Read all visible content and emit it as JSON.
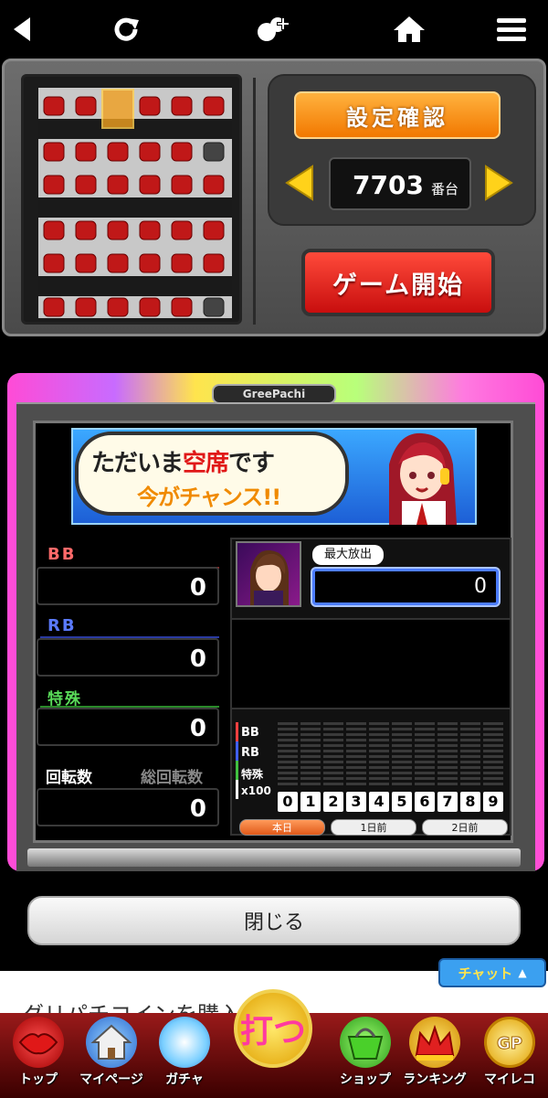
{
  "header": {
    "back_icon": "back-arrow-icon",
    "reload_icon": "reload-icon",
    "friend_icon": "add-friend-icon",
    "home_icon": "home-icon",
    "menu_icon": "hamburger-menu-icon"
  },
  "hall_selector": {
    "settei_button": "設定確認",
    "machine_number": "7703",
    "machine_unit": "番台",
    "start_button": "ゲーム開始"
  },
  "machine": {
    "brand": "GreePachi",
    "banner": {
      "line1_a": "ただいま",
      "line1_b": "空席",
      "line1_c": "です",
      "line2": "今がチャンス!!"
    },
    "stats": {
      "bb_label": "BB",
      "bb_value": "0",
      "rb_label": "RB",
      "rb_value": "0",
      "special_label": "特殊",
      "special_value": "0",
      "spin_label": "回転数",
      "total_spin_label": "総回転数",
      "spin_value": "0"
    },
    "max_payout_label": "最大放出",
    "max_payout_value": "0",
    "graph": {
      "row_labels": [
        "BB",
        "RB",
        "特殊",
        "x100"
      ],
      "digits": [
        "0",
        "1",
        "2",
        "3",
        "4",
        "5",
        "6",
        "7",
        "8",
        "9"
      ]
    },
    "days": [
      "本日",
      "1日前",
      "2日前"
    ]
  },
  "close_button": "閉じる",
  "chat_button": "チャット",
  "buy_coins_text": "グリパチコインを購入す",
  "bottom_nav": [
    {
      "label": "トップ",
      "icon": "lips-icon"
    },
    {
      "label": "マイページ",
      "icon": "house-icon"
    },
    {
      "label": "ガチャ",
      "icon": "gacha-orb-icon"
    },
    {
      "label": "打つ",
      "icon": "play-icon"
    },
    {
      "label": "ショップ",
      "icon": "shopping-basket-icon"
    },
    {
      "label": "ランキング",
      "icon": "crown-icon"
    },
    {
      "label": "マイレコ",
      "icon": "gp-coin-icon"
    }
  ],
  "colors": {
    "accent_orange": "#f27800",
    "start_red": "#c80e0e",
    "bb_red": "#ff6a6a",
    "rb_blue": "#5a7aff",
    "special_green": "#5adc5a",
    "nav_red": "#9a1a1a"
  }
}
